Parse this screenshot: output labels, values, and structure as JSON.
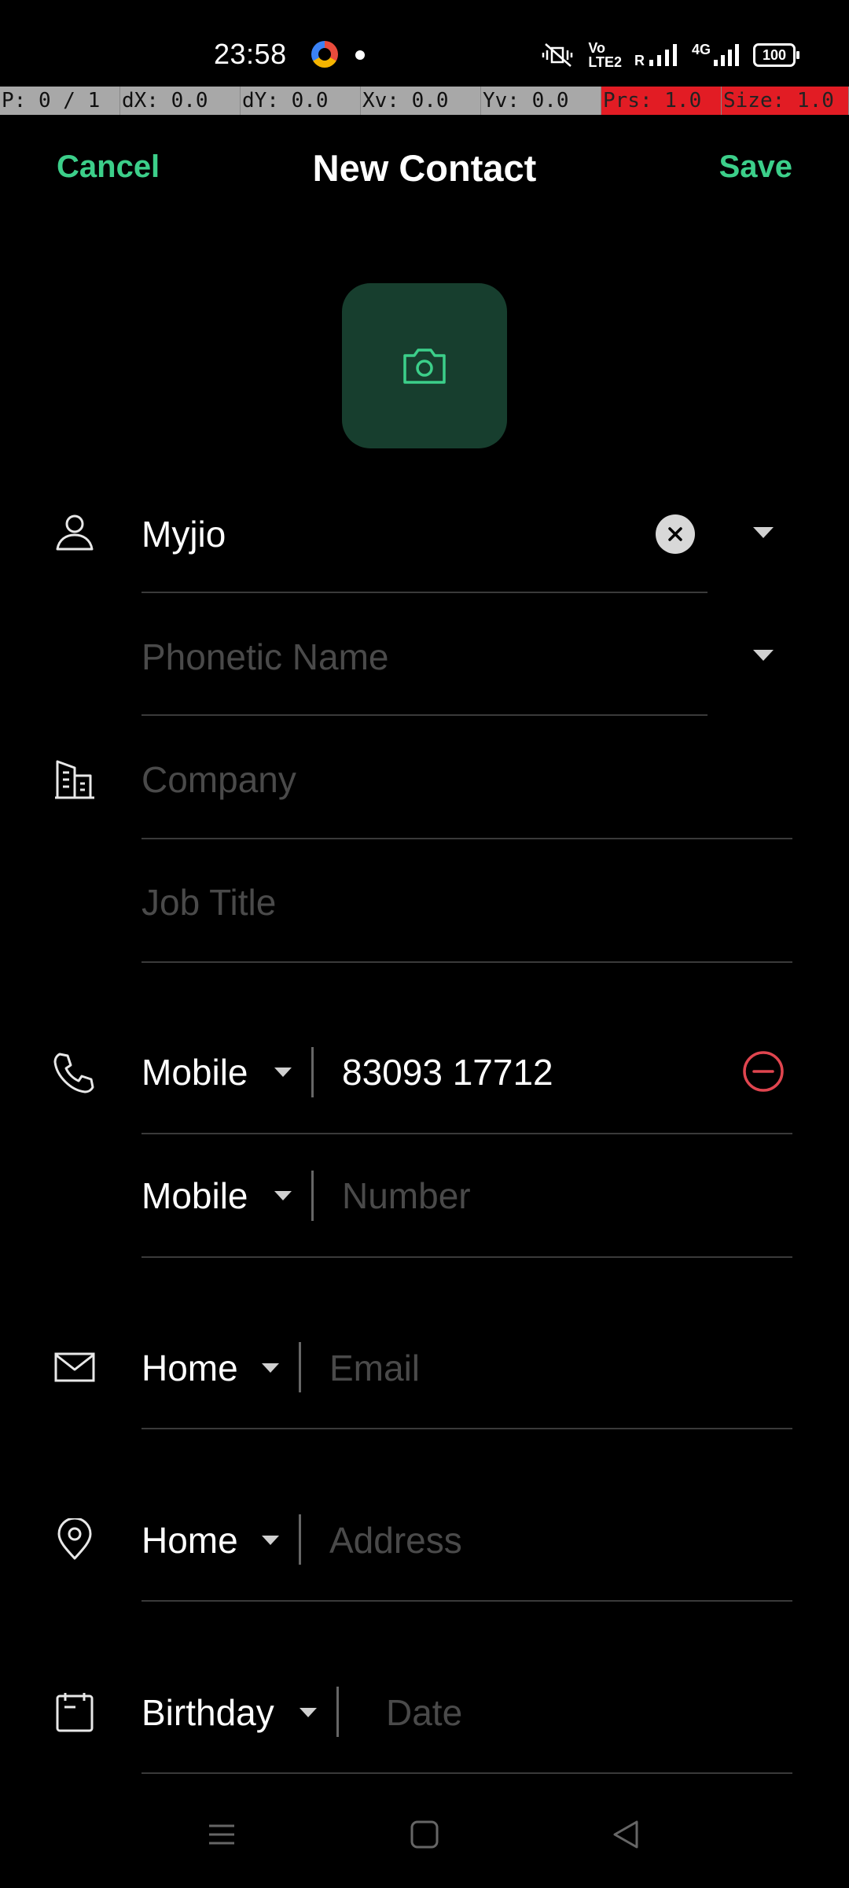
{
  "status_bar": {
    "time": "23:58",
    "network_label_top": "Vo",
    "network_label_bottom": "LTE2",
    "roaming": "R",
    "data_type": "4G",
    "battery": "100"
  },
  "debug_bar": {
    "pointer": "P: 0 / 1",
    "dx": "dX: 0.0",
    "dy": "dY: 0.0",
    "xv": "Xv: 0.0",
    "yv": "Yv: 0.0",
    "prs": "Prs: 1.0",
    "size": "Size: 1.0"
  },
  "header": {
    "cancel_label": "Cancel",
    "title": "New Contact",
    "save_label": "Save"
  },
  "name": {
    "value": "Myjio",
    "phonetic_placeholder": "Phonetic Name"
  },
  "work": {
    "company_placeholder": "Company",
    "job_title_placeholder": "Job Title"
  },
  "phones": [
    {
      "type": "Mobile",
      "value": "83093 17712"
    },
    {
      "type": "Mobile",
      "placeholder": "Number"
    }
  ],
  "email": {
    "type": "Home",
    "placeholder": "Email"
  },
  "address": {
    "type": "Home",
    "placeholder": "Address"
  },
  "date": {
    "type": "Birthday",
    "placeholder": "Date"
  },
  "colors": {
    "accent": "#3ccf8a",
    "danger": "#e0454f",
    "photo_bg": "#173e2e"
  },
  "icons": {
    "photo": "camera-icon",
    "name": "person-icon",
    "company": "building-icon",
    "phone": "phone-icon",
    "email": "mail-icon",
    "address": "location-pin-icon",
    "date": "calendar-icon"
  }
}
